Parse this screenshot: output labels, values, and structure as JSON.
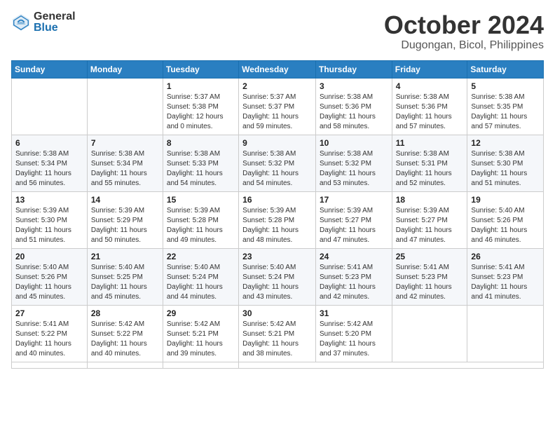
{
  "logo": {
    "general": "General",
    "blue": "Blue"
  },
  "header": {
    "month": "October 2024",
    "location": "Dugongan, Bicol, Philippines"
  },
  "weekdays": [
    "Sunday",
    "Monday",
    "Tuesday",
    "Wednesday",
    "Thursday",
    "Friday",
    "Saturday"
  ],
  "days": [
    {
      "num": "",
      "content": ""
    },
    {
      "num": "",
      "content": ""
    },
    {
      "num": "1",
      "content": "Sunrise: 5:37 AM\nSunset: 5:38 PM\nDaylight: 12 hours and 0 minutes."
    },
    {
      "num": "2",
      "content": "Sunrise: 5:37 AM\nSunset: 5:37 PM\nDaylight: 11 hours and 59 minutes."
    },
    {
      "num": "3",
      "content": "Sunrise: 5:38 AM\nSunset: 5:36 PM\nDaylight: 11 hours and 58 minutes."
    },
    {
      "num": "4",
      "content": "Sunrise: 5:38 AM\nSunset: 5:36 PM\nDaylight: 11 hours and 57 minutes."
    },
    {
      "num": "5",
      "content": "Sunrise: 5:38 AM\nSunset: 5:35 PM\nDaylight: 11 hours and 57 minutes."
    },
    {
      "num": "6",
      "content": "Sunrise: 5:38 AM\nSunset: 5:34 PM\nDaylight: 11 hours and 56 minutes."
    },
    {
      "num": "7",
      "content": "Sunrise: 5:38 AM\nSunset: 5:34 PM\nDaylight: 11 hours and 55 minutes."
    },
    {
      "num": "8",
      "content": "Sunrise: 5:38 AM\nSunset: 5:33 PM\nDaylight: 11 hours and 54 minutes."
    },
    {
      "num": "9",
      "content": "Sunrise: 5:38 AM\nSunset: 5:32 PM\nDaylight: 11 hours and 54 minutes."
    },
    {
      "num": "10",
      "content": "Sunrise: 5:38 AM\nSunset: 5:32 PM\nDaylight: 11 hours and 53 minutes."
    },
    {
      "num": "11",
      "content": "Sunrise: 5:38 AM\nSunset: 5:31 PM\nDaylight: 11 hours and 52 minutes."
    },
    {
      "num": "12",
      "content": "Sunrise: 5:38 AM\nSunset: 5:30 PM\nDaylight: 11 hours and 51 minutes."
    },
    {
      "num": "13",
      "content": "Sunrise: 5:39 AM\nSunset: 5:30 PM\nDaylight: 11 hours and 51 minutes."
    },
    {
      "num": "14",
      "content": "Sunrise: 5:39 AM\nSunset: 5:29 PM\nDaylight: 11 hours and 50 minutes."
    },
    {
      "num": "15",
      "content": "Sunrise: 5:39 AM\nSunset: 5:28 PM\nDaylight: 11 hours and 49 minutes."
    },
    {
      "num": "16",
      "content": "Sunrise: 5:39 AM\nSunset: 5:28 PM\nDaylight: 11 hours and 48 minutes."
    },
    {
      "num": "17",
      "content": "Sunrise: 5:39 AM\nSunset: 5:27 PM\nDaylight: 11 hours and 47 minutes."
    },
    {
      "num": "18",
      "content": "Sunrise: 5:39 AM\nSunset: 5:27 PM\nDaylight: 11 hours and 47 minutes."
    },
    {
      "num": "19",
      "content": "Sunrise: 5:40 AM\nSunset: 5:26 PM\nDaylight: 11 hours and 46 minutes."
    },
    {
      "num": "20",
      "content": "Sunrise: 5:40 AM\nSunset: 5:26 PM\nDaylight: 11 hours and 45 minutes."
    },
    {
      "num": "21",
      "content": "Sunrise: 5:40 AM\nSunset: 5:25 PM\nDaylight: 11 hours and 45 minutes."
    },
    {
      "num": "22",
      "content": "Sunrise: 5:40 AM\nSunset: 5:24 PM\nDaylight: 11 hours and 44 minutes."
    },
    {
      "num": "23",
      "content": "Sunrise: 5:40 AM\nSunset: 5:24 PM\nDaylight: 11 hours and 43 minutes."
    },
    {
      "num": "24",
      "content": "Sunrise: 5:41 AM\nSunset: 5:23 PM\nDaylight: 11 hours and 42 minutes."
    },
    {
      "num": "25",
      "content": "Sunrise: 5:41 AM\nSunset: 5:23 PM\nDaylight: 11 hours and 42 minutes."
    },
    {
      "num": "26",
      "content": "Sunrise: 5:41 AM\nSunset: 5:23 PM\nDaylight: 11 hours and 41 minutes."
    },
    {
      "num": "27",
      "content": "Sunrise: 5:41 AM\nSunset: 5:22 PM\nDaylight: 11 hours and 40 minutes."
    },
    {
      "num": "28",
      "content": "Sunrise: 5:42 AM\nSunset: 5:22 PM\nDaylight: 11 hours and 40 minutes."
    },
    {
      "num": "29",
      "content": "Sunrise: 5:42 AM\nSunset: 5:21 PM\nDaylight: 11 hours and 39 minutes."
    },
    {
      "num": "30",
      "content": "Sunrise: 5:42 AM\nSunset: 5:21 PM\nDaylight: 11 hours and 38 minutes."
    },
    {
      "num": "31",
      "content": "Sunrise: 5:42 AM\nSunset: 5:20 PM\nDaylight: 11 hours and 37 minutes."
    },
    {
      "num": "",
      "content": ""
    },
    {
      "num": "",
      "content": ""
    },
    {
      "num": "",
      "content": ""
    },
    {
      "num": "",
      "content": ""
    },
    {
      "num": "",
      "content": ""
    }
  ]
}
